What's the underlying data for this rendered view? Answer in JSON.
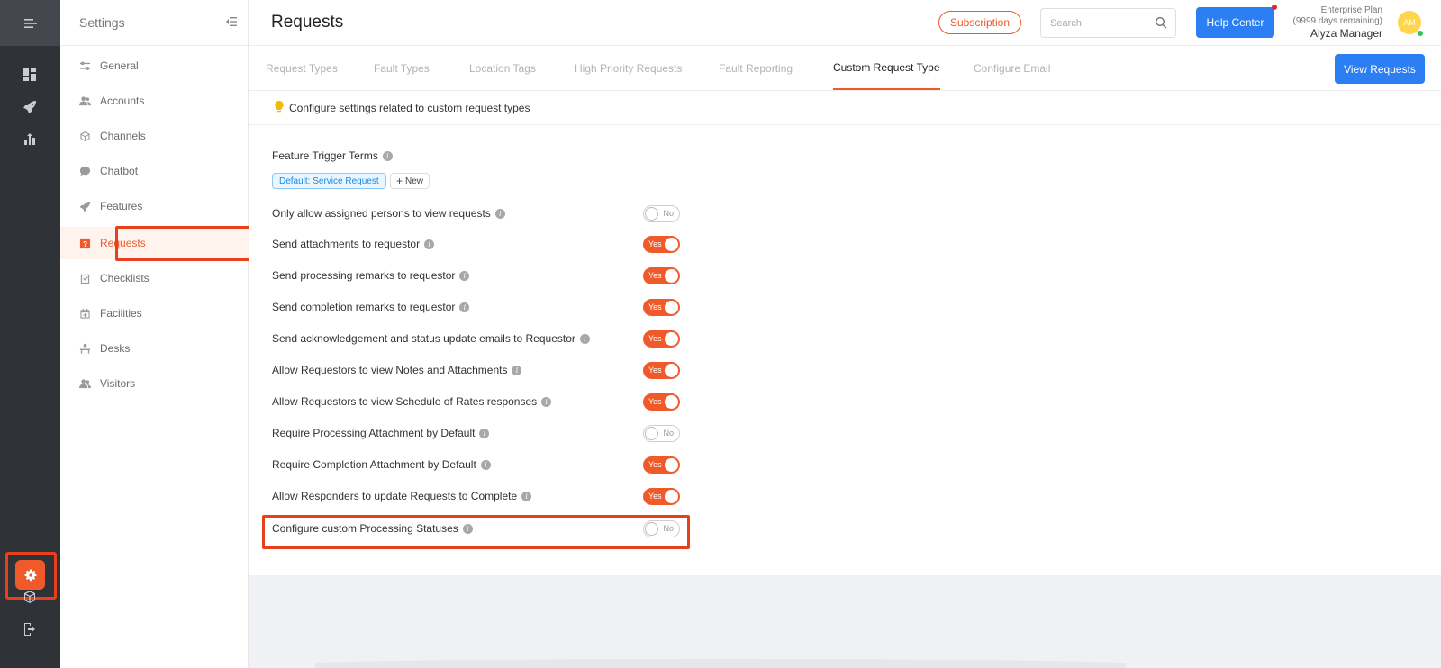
{
  "rail": {
    "icons": [
      "menu-expand-icon",
      "dashboard-icon",
      "rocket-icon",
      "analytics-icon",
      "settings-gear-icon",
      "package-icon",
      "logout-icon"
    ]
  },
  "sidebar": {
    "title": "Settings",
    "items": [
      {
        "label": "General",
        "icon": "sliders-icon",
        "active": false
      },
      {
        "label": "Accounts",
        "icon": "users-icon",
        "active": false
      },
      {
        "label": "Channels",
        "icon": "cube-icon",
        "active": false
      },
      {
        "label": "Chatbot",
        "icon": "chat-icon",
        "active": false
      },
      {
        "label": "Features",
        "icon": "rocket-icon",
        "active": false
      },
      {
        "label": "Requests",
        "icon": "question-box-icon",
        "active": true
      },
      {
        "label": "Checklists",
        "icon": "checklist-icon",
        "active": false
      },
      {
        "label": "Facilities",
        "icon": "calendar-plus-icon",
        "active": false
      },
      {
        "label": "Desks",
        "icon": "desk-icon",
        "active": false
      },
      {
        "label": "Visitors",
        "icon": "visitors-icon",
        "active": false
      }
    ]
  },
  "header": {
    "title": "Requests",
    "subscription_label": "Subscription",
    "search_placeholder": "Search",
    "search_value": "",
    "help_label": "Help Center",
    "plan_name": "Enterprise Plan",
    "plan_remaining": "(9999 days remaining)",
    "user_name": "Alyza Manager",
    "avatar_initials": "AM"
  },
  "tabs": {
    "items": [
      {
        "label": "Request Types",
        "active": false
      },
      {
        "label": "Fault Types",
        "active": false
      },
      {
        "label": "Location Tags",
        "active": false
      },
      {
        "label": "High Priority Requests",
        "active": false
      },
      {
        "label": "Fault Reporting",
        "active": false
      },
      {
        "label": "Custom Request Type",
        "active": true
      },
      {
        "label": "Configure Email",
        "active": false
      }
    ],
    "view_requests_label": "View Requests"
  },
  "tip": {
    "text": "Configure settings related to custom request types"
  },
  "feature_trigger": {
    "label": "Feature Trigger Terms",
    "tag": "Default: Service Request",
    "new_label": "New"
  },
  "settings": [
    {
      "label": "Only allow assigned persons to view requests",
      "value": "No"
    },
    {
      "label": "Send attachments to requestor",
      "value": "Yes"
    },
    {
      "label": "Send processing remarks to requestor",
      "value": "Yes"
    },
    {
      "label": "Send completion remarks to requestor",
      "value": "Yes"
    },
    {
      "label": "Send acknowledgement and status update emails to Requestor",
      "value": "Yes"
    },
    {
      "label": "Allow Requestors to view Notes and Attachments",
      "value": "Yes"
    },
    {
      "label": "Allow Requestors to view Schedule of Rates responses",
      "value": "Yes"
    },
    {
      "label": "Require Processing Attachment by Default",
      "value": "No"
    },
    {
      "label": "Require Completion Attachment by Default",
      "value": "Yes"
    },
    {
      "label": "Allow Responders to update Requests to Complete",
      "value": "Yes"
    },
    {
      "label": "Configure custom Processing Statuses",
      "value": "No"
    }
  ],
  "colors": {
    "accent": "#f05a2a",
    "primary_button": "#2b7ff2",
    "rail_bg": "#2f3237",
    "highlight_box": "#e8401c"
  }
}
